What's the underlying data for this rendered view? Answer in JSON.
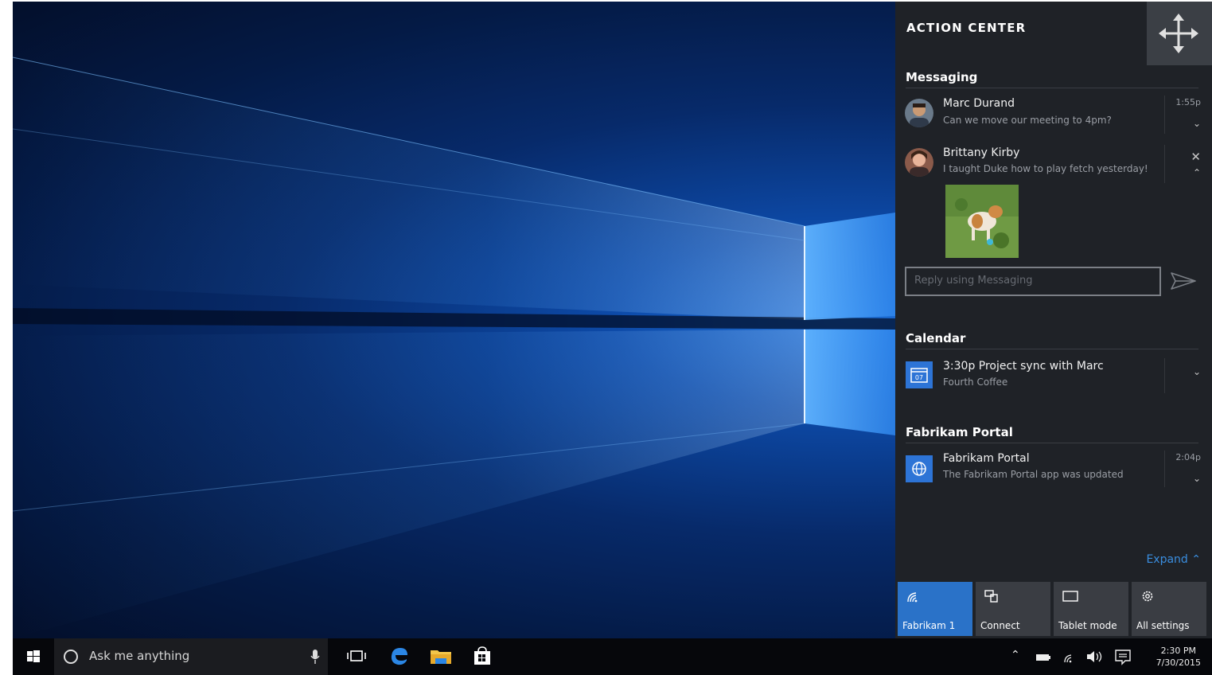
{
  "action_center": {
    "title": "ACTION CENTER",
    "sections": {
      "messaging": "Messaging",
      "calendar": "Calendar",
      "fabrikam": "Fabrikam Portal"
    },
    "notifications": {
      "marc": {
        "title": "Marc Durand",
        "body": "Can we move our meeting to 4pm?",
        "time": "1:55p"
      },
      "brittany": {
        "title": "Brittany Kirby",
        "body": "I taught Duke how to play fetch yesterday!"
      },
      "calendar": {
        "title": "3:30p  Project sync with Marc",
        "body": "Fourth Coffee",
        "icon_day": "07"
      },
      "fabrikam": {
        "title": "Fabrikam Portal",
        "body": "The Fabrikam Portal app was updated",
        "time": "2:04p"
      }
    },
    "reply_placeholder": "Reply using Messaging",
    "expand_label": "Expand",
    "quick_actions": [
      {
        "label": "Fabrikam 1",
        "icon": "wifi-icon",
        "active": true
      },
      {
        "label": "Connect",
        "icon": "connect-icon",
        "active": false
      },
      {
        "label": "Tablet mode",
        "icon": "tablet-icon",
        "active": false
      },
      {
        "label": "All settings",
        "icon": "gear-icon",
        "active": false
      }
    ],
    "accent_color": "#2a72c8"
  },
  "taskbar": {
    "search_placeholder": "Ask me anything",
    "clock_time": "2:30 PM",
    "clock_date": "7/30/2015"
  }
}
